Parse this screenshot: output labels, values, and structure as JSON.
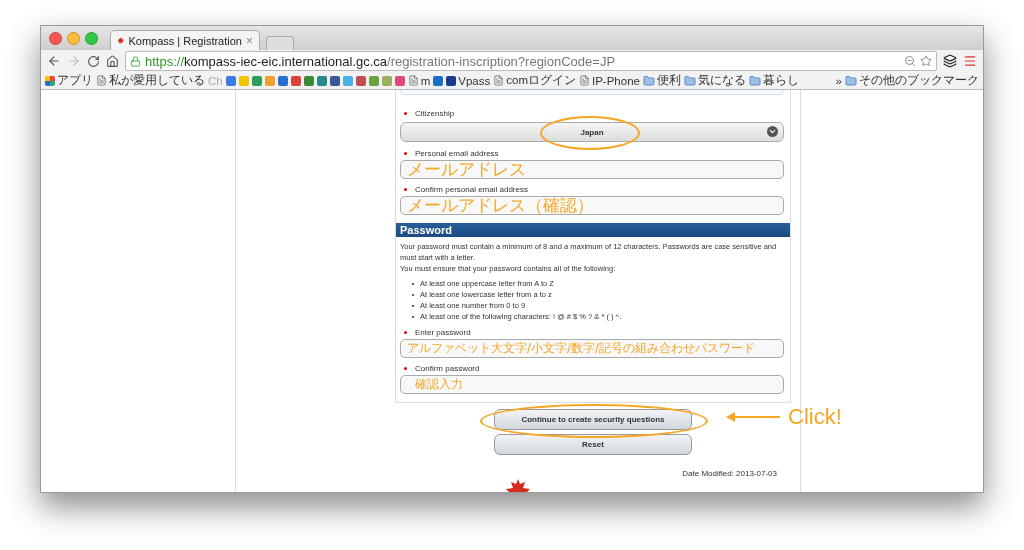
{
  "tab": {
    "title": "Kompass | Registration",
    "close": "×"
  },
  "url": {
    "scheme": "https://",
    "host": "kompass-iec-eic.international.gc.ca",
    "path": "/registration-inscription?regionCode=JP"
  },
  "bookmarks": [
    {
      "kind": "apps",
      "label": "アプリ"
    },
    {
      "kind": "page",
      "label": "私が愛用している"
    },
    {
      "kind": "faded",
      "label": "Ch"
    },
    {
      "kind": "icon",
      "color": "#3b7de0"
    },
    {
      "kind": "icon",
      "color": "#f2c500"
    },
    {
      "kind": "icon",
      "color": "#2aa05a"
    },
    {
      "kind": "icon",
      "color": "#f0a030"
    },
    {
      "kind": "icon",
      "color": "#2a6fd0"
    },
    {
      "kind": "icon",
      "color": "#d8433a"
    },
    {
      "kind": "icon",
      "color": "#3a8a3a"
    },
    {
      "kind": "icon",
      "color": "#2a8a8a"
    },
    {
      "kind": "icon",
      "color": "#3b5998"
    },
    {
      "kind": "icon",
      "color": "#4ab0e8"
    },
    {
      "kind": "icon",
      "color": "#c05050"
    },
    {
      "kind": "icon",
      "color": "#6aa040"
    },
    {
      "kind": "icon",
      "color": "#9ab060"
    },
    {
      "kind": "icon",
      "color": "#e04a7a"
    },
    {
      "kind": "page",
      "label": "m"
    },
    {
      "kind": "icon",
      "color": "#1a6ec8"
    },
    {
      "kind": "logo",
      "label": "Vpass",
      "color": "#1a3a8a"
    },
    {
      "kind": "page",
      "label": "comログイン"
    },
    {
      "kind": "page",
      "label": "IP-Phone"
    },
    {
      "kind": "folder",
      "label": "便利"
    },
    {
      "kind": "folder",
      "label": "気になる"
    },
    {
      "kind": "folder",
      "label": "暮らし"
    }
  ],
  "bookmarks_more": "»",
  "bookmarks_other": "その他のブックマーク",
  "form": {
    "citizenship": {
      "label": "Citizenship",
      "value": "Japan"
    },
    "email": {
      "label": "Personal email address",
      "annotation": "メールアドレス"
    },
    "email_confirm": {
      "label": "Confirm personal email address",
      "annotation": "メールアドレス（確認）"
    },
    "password_section": {
      "title": "Password",
      "intro": "Your password must contain a minimum of 8 and a maximum of 12 characters. Passwords are case sensitive and must start with a letter.",
      "intro2": "You must ensure that your password contains all of the following:",
      "rules": [
        "At least one uppercase letter from A to Z",
        "At least one lowercase letter from a to z",
        "At least one number from 0 to 9",
        "At least one of the following characters: ! @ # $ % ? & * ( ) ^."
      ]
    },
    "password": {
      "label": "Enter password",
      "annotation": "アルファベット大文字/小文字/数字/記号の組み合わせパスワード"
    },
    "password_confirm": {
      "label": "Confirm password",
      "annotation": "確認入力"
    },
    "continue_button": "Continue to create security questions",
    "reset_button": "Reset",
    "click_note": "Click!"
  },
  "date_modified": "Date Modified: 2013-07-03"
}
